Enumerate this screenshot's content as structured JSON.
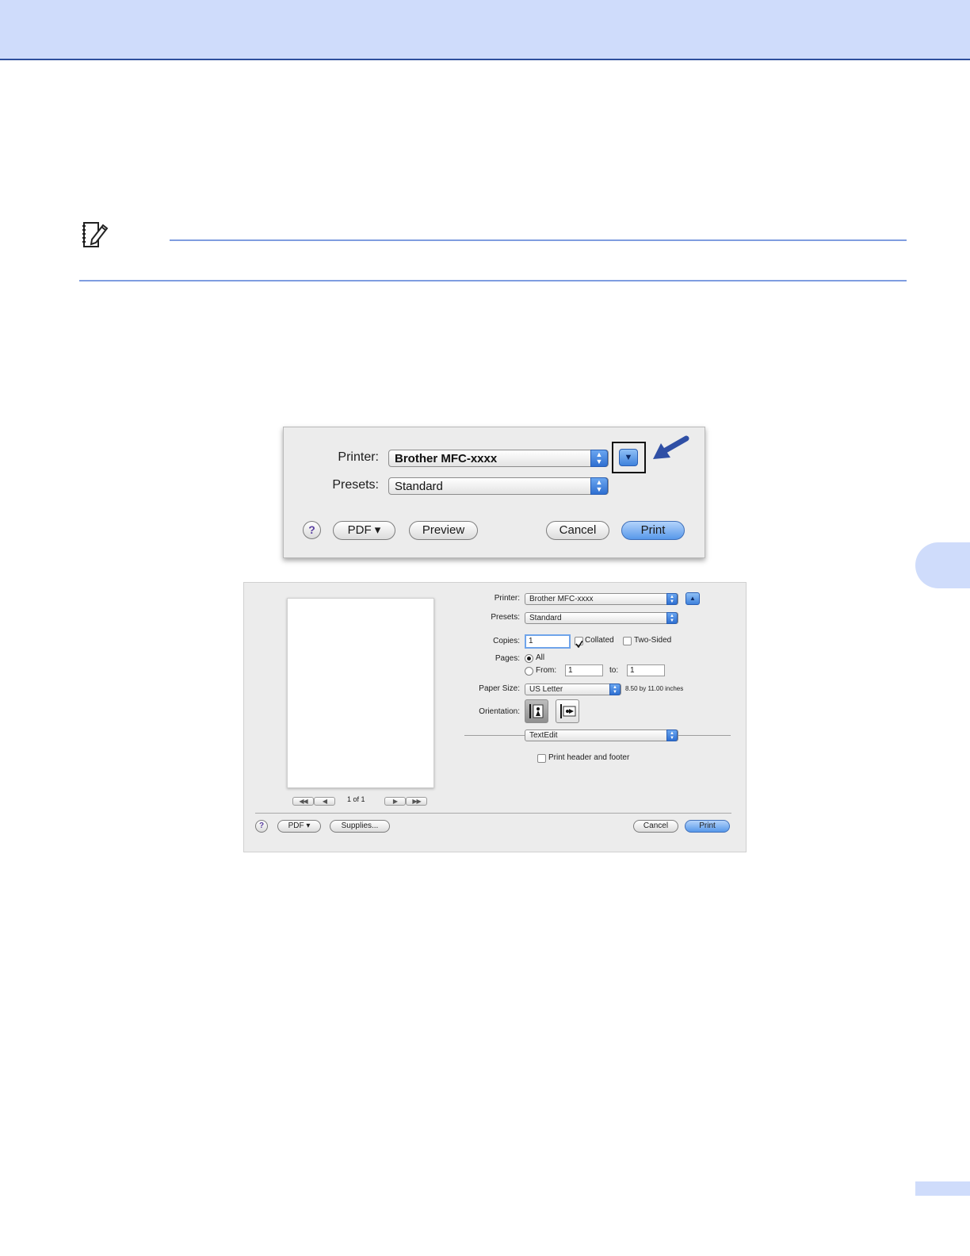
{
  "dialog_collapsed": {
    "printer_label": "Printer:",
    "printer_value": "Brother MFC-xxxx",
    "presets_label": "Presets:",
    "presets_value": "Standard",
    "help": "?",
    "pdf_button": "PDF ▾",
    "preview_button": "Preview",
    "cancel_button": "Cancel",
    "print_button": "Print",
    "disclosure_icon": "disclosure-down-icon",
    "arrow_color": "#2f4fa5"
  },
  "dialog_expanded": {
    "printer_label": "Printer:",
    "printer_value": "Brother MFC-xxxx",
    "presets_label": "Presets:",
    "presets_value": "Standard",
    "copies_label": "Copies:",
    "copies_value": "1",
    "collated_label": "Collated",
    "collated_checked": true,
    "two_sided_label": "Two-Sided",
    "pages_label": "Pages:",
    "all_label": "All",
    "from_label": "From:",
    "from_value": "1",
    "to_label": "to:",
    "to_value": "1",
    "paper_size_label": "Paper Size:",
    "paper_size_value": "US Letter",
    "paper_size_dims": "8.50 by 11.00 inches",
    "orientation_label": "Orientation:",
    "section_popup": "TextEdit",
    "header_footer_label": "Print header and footer",
    "page_counter": "1 of 1",
    "help": "?",
    "pdf_button": "PDF ▾",
    "supplies_button": "Supplies...",
    "cancel_button": "Cancel",
    "print_button": "Print"
  },
  "colors": {
    "header_band": "#cfdcfb",
    "header_rule": "#2e4f9c",
    "note_rule": "#7f9de0",
    "accent_blue": "#5798ea"
  }
}
